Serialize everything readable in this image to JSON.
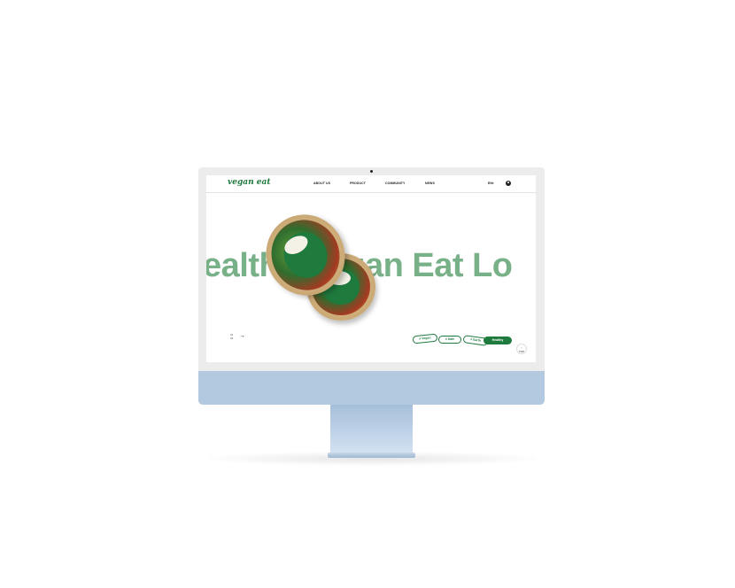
{
  "navbar": {
    "logo": "vegan eat",
    "items": [
      {
        "label": "ABOUT US"
      },
      {
        "label": "PRODUCT"
      },
      {
        "label": "COMMUNITY"
      },
      {
        "label": "NEWS"
      }
    ],
    "language": "EN",
    "language_caret": "▾",
    "user_icon": "user-icon"
  },
  "hero": {
    "headline": "ealthy Vegan Eat Lo",
    "pager": {
      "current": "01",
      "total": "04"
    },
    "next_arrow": "→"
  },
  "tags": [
    {
      "label": "# Vegan"
    },
    {
      "label": "# Safe"
    },
    {
      "label": "# Earth"
    },
    {
      "label": "Healthy"
    }
  ],
  "top_button": {
    "arrow": "↑",
    "label": "TOP"
  },
  "colors": {
    "brand_green": "#1f7a3e",
    "hero_text": "#78b088",
    "monitor_chin": "#b3c9e0"
  }
}
